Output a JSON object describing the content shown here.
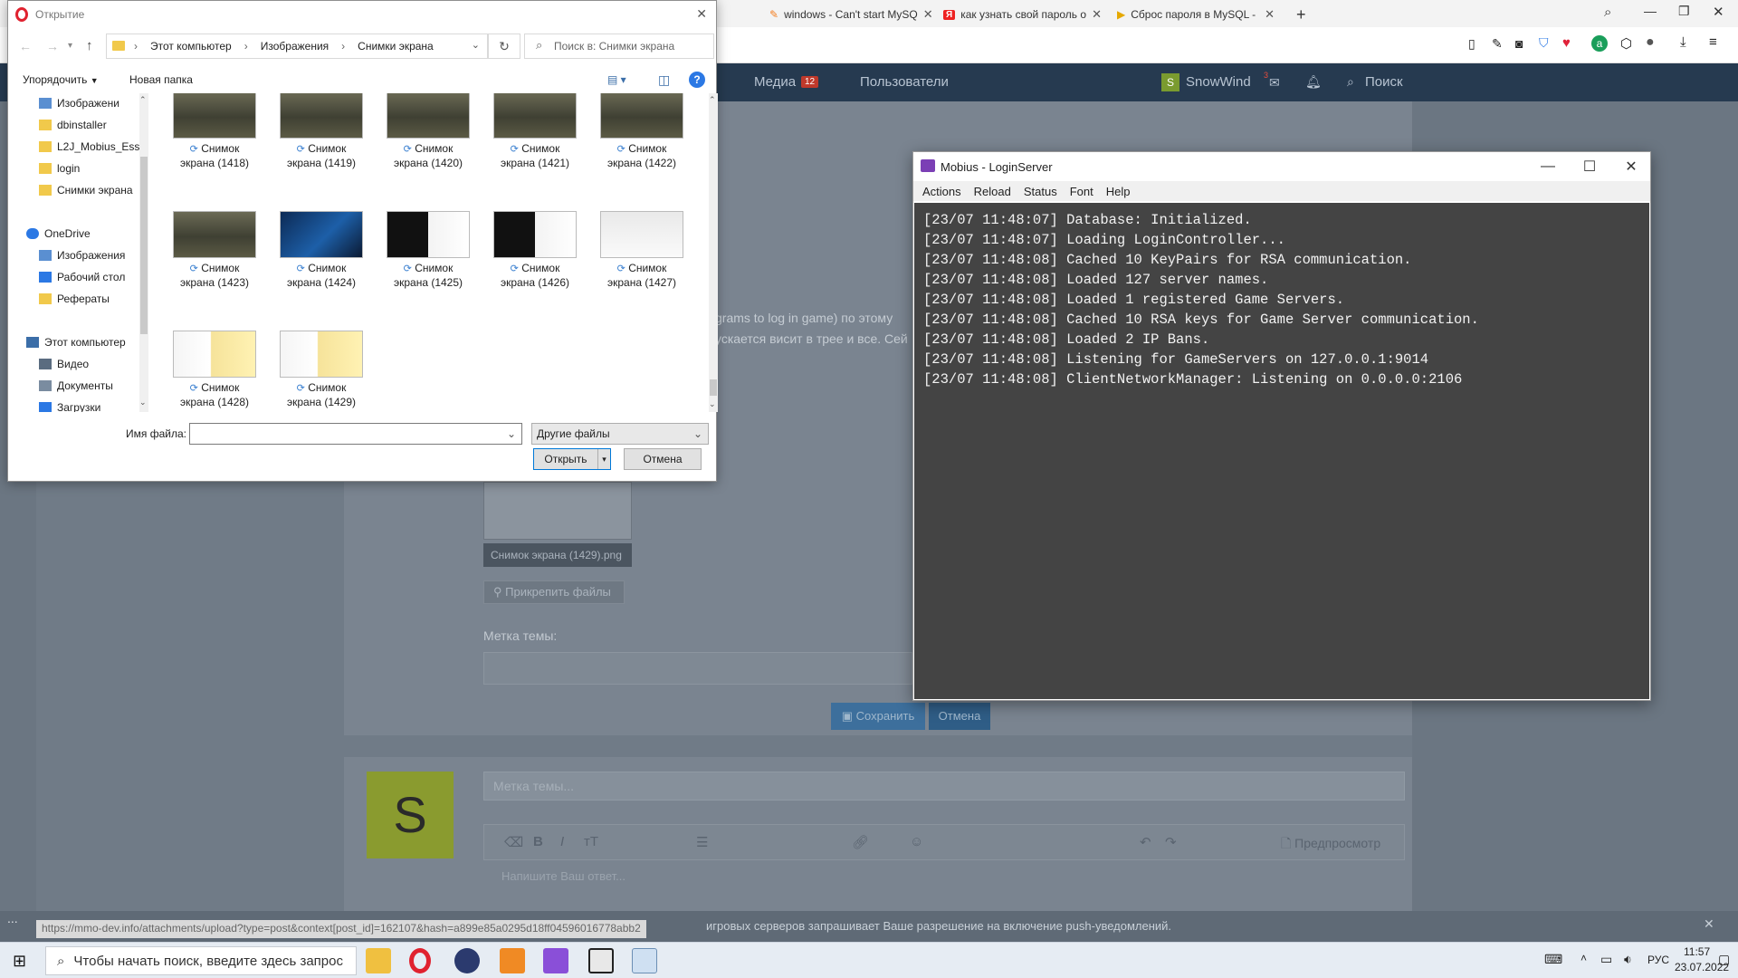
{
  "browser": {
    "tabs": [
      {
        "label": "windows - Can't start MySQ",
        "icon": "stackoverflow-icon"
      },
      {
        "label": "как узнать свой пароль о",
        "icon": "yandex-icon"
      },
      {
        "label": "Сброс пароля в MySQL - ",
        "icon": "youtube-icon"
      }
    ],
    "new_tab": "+"
  },
  "site": {
    "nav": {
      "media": "Медиа",
      "media_badge": "12",
      "users": "Пользователи",
      "user": "SnowWind",
      "user_badge": "3",
      "search": "Поиск"
    },
    "attachment_name": "Снимок экрана (1429).png",
    "attach_label": "Прикрепить файлы",
    "topic_label": "Метка темы:",
    "save_label": "Сохранить",
    "cancel_label": "Отмена",
    "reply_topic_placeholder": "Метка темы...",
    "reply_placeholder": "Напишите Ваш ответ...",
    "preview_label": "Предпросмотр",
    "avatar_letter": "S",
    "snippet1": "grams to log in game) по этому",
    "snippet2": "ускается висит в трее и все. Сей",
    "notif_text": "игровых серверов запрашивает Ваше разрешение на включение push-уведомлений.",
    "status_url": "https://mmo-dev.info/attachments/upload?type=post&context[post_id]=162107&hash=a899e85a0295d18ff04596016778abb2",
    "dots": "..."
  },
  "dialog": {
    "title": "Открытие",
    "path": [
      "Этот компьютер",
      "Изображения",
      "Снимки экрана"
    ],
    "search_placeholder": "Поиск в: Снимки экрана",
    "organize": "Упорядочить",
    "new_folder": "Новая папка",
    "help": "?",
    "tree": [
      {
        "label": "Изображени",
        "icon": "pictures-icon",
        "indent": 1
      },
      {
        "label": "dbinstaller",
        "icon": "folder-icon",
        "indent": 1
      },
      {
        "label": "L2J_Mobius_Esse",
        "icon": "folder-icon",
        "indent": 1
      },
      {
        "label": "login",
        "icon": "folder-icon",
        "indent": 1
      },
      {
        "label": "Снимки экрана",
        "icon": "folder-icon",
        "indent": 1
      },
      {
        "label": "",
        "icon": "",
        "indent": 0
      },
      {
        "label": "OneDrive",
        "icon": "cloud-icon",
        "indent": 0
      },
      {
        "label": "Изображения",
        "icon": "pictures-icon",
        "indent": 1
      },
      {
        "label": "Рабочий стол",
        "icon": "desktop-icon",
        "indent": 1
      },
      {
        "label": "Рефераты",
        "icon": "folder-icon",
        "indent": 1
      },
      {
        "label": "",
        "icon": "",
        "indent": 0
      },
      {
        "label": "Этот компьютер",
        "icon": "pc-icon",
        "indent": 0
      },
      {
        "label": "Видео",
        "icon": "video-icon",
        "indent": 1
      },
      {
        "label": "Документы",
        "icon": "documents-icon",
        "indent": 1
      },
      {
        "label": "Загрузки",
        "icon": "downloads-icon",
        "indent": 1
      },
      {
        "label": "Изображения",
        "icon": "pictures-icon",
        "indent": 1
      }
    ],
    "files": [
      {
        "l1": "Снимок",
        "l2": "экрана (1418)",
        "kind": "game"
      },
      {
        "l1": "Снимок",
        "l2": "экрана (1419)",
        "kind": "game"
      },
      {
        "l1": "Снимок",
        "l2": "экрана (1420)",
        "kind": "game"
      },
      {
        "l1": "Снимок",
        "l2": "экрана (1421)",
        "kind": "game"
      },
      {
        "l1": "Снимок",
        "l2": "экрана (1422)",
        "kind": "game"
      },
      {
        "l1": "Снимок",
        "l2": "экрана (1423)",
        "kind": "game"
      },
      {
        "l1": "Снимок",
        "l2": "экрана (1424)",
        "kind": "desktop"
      },
      {
        "l1": "Снимок",
        "l2": "экрана (1425)",
        "kind": "console"
      },
      {
        "l1": "Снимок",
        "l2": "экрана (1426)",
        "kind": "console"
      },
      {
        "l1": "Снимок",
        "l2": "экрана (1427)",
        "kind": "window"
      },
      {
        "l1": "Снимок",
        "l2": "экрана (1428)",
        "kind": "explorer"
      },
      {
        "l1": "Снимок",
        "l2": "экрана (1429)",
        "kind": "explorer"
      }
    ],
    "filename_label": "Имя файла:",
    "filename_value": "",
    "filter": "Другие файлы",
    "open": "Открыть",
    "cancel": "Отмена"
  },
  "mobius": {
    "title": "Mobius - LoginServer",
    "menu": [
      "Actions",
      "Reload",
      "Status",
      "Font",
      "Help"
    ],
    "log": [
      "[23/07 11:48:07] Database: Initialized.",
      "[23/07 11:48:07] Loading LoginController...",
      "[23/07 11:48:08] Cached 10 KeyPairs for RSA communication.",
      "[23/07 11:48:08] Loaded 127 server names.",
      "[23/07 11:48:08] Loaded 1 registered Game Servers.",
      "[23/07 11:48:08] Cached 10 RSA keys for Game Server communication.",
      "[23/07 11:48:08] Loaded 2 IP Bans.",
      "[23/07 11:48:08] Listening for GameServers on 127.0.0.1:9014",
      "[23/07 11:48:08] ClientNetworkManager: Listening on 0.0.0.0:2106"
    ]
  },
  "taskbar": {
    "search_placeholder": "Чтобы начать поиск, введите здесь запрос",
    "lang": "РУС",
    "time": "11:57",
    "date": "23.07.2022"
  },
  "colors": {
    "accent": "#0078d7",
    "nav_bg": "#263a50",
    "console_bg": "#444444",
    "save_btn": "#3d6f9c"
  }
}
